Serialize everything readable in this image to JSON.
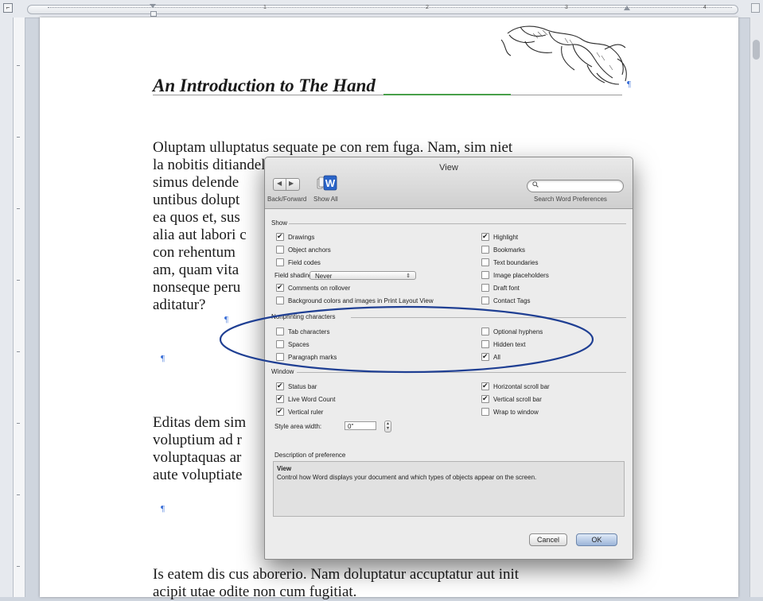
{
  "ruler": {
    "numbers": [
      "1",
      "2",
      "3",
      "4"
    ]
  },
  "document": {
    "title": "An Introduction to The Hand",
    "paragraph1": "Oluptam ulluptatus sequate pe con rem fuga. Nam, sim niet\nla nobitis ditiandel id ut a quae omnimolut et as ex et enis\nsimus delende\nuntibus dolupt\nea quos et, sus\nalia aut labori c\ncon rehentum\nam, quam vita\nnonseque peru\naditatur?",
    "paragraph2": "Editas dem sim\nvoluptium ad r\nvoluptaquas ar\naute voluptiate",
    "paragraph3": "Is eatem dis cus aborerio. Nam doluptatur accuptatur aut init\nacipit utae odite non cum fugitiat.",
    "pilcrow": "¶"
  },
  "dialog": {
    "title": "View",
    "back_forward_label": "Back/Forward",
    "show_all_label": "Show All",
    "search_caption": "Search Word Preferences",
    "search_placeholder": "",
    "groups": {
      "show": "Show",
      "nonprinting": "Nonprinting characters",
      "window": "Window",
      "description": "Description of preference"
    },
    "show_left": [
      {
        "label": "Drawings",
        "checked": true
      },
      {
        "label": "Object anchors",
        "checked": false
      },
      {
        "label": "Field codes",
        "checked": false
      }
    ],
    "field_shading_label": "Field shading:",
    "field_shading_value": "Never",
    "show_left2": [
      {
        "label": "Comments on rollover",
        "checked": true
      },
      {
        "label": "Background colors and images in Print Layout View",
        "checked": false
      }
    ],
    "show_right": [
      {
        "label": "Highlight",
        "checked": true
      },
      {
        "label": "Bookmarks",
        "checked": false
      },
      {
        "label": "Text boundaries",
        "checked": false
      },
      {
        "label": "Image placeholders",
        "checked": false
      },
      {
        "label": "Draft font",
        "checked": false
      },
      {
        "label": "Contact Tags",
        "checked": false
      }
    ],
    "nonprinting_left": [
      {
        "label": "Tab characters",
        "checked": false
      },
      {
        "label": "Spaces",
        "checked": false
      },
      {
        "label": "Paragraph marks",
        "checked": false
      }
    ],
    "nonprinting_right": [
      {
        "label": "Optional hyphens",
        "checked": false
      },
      {
        "label": "Hidden text",
        "checked": false
      },
      {
        "label": "All",
        "checked": true
      }
    ],
    "window_left": [
      {
        "label": "Status bar",
        "checked": true
      },
      {
        "label": "Live Word Count",
        "checked": true
      },
      {
        "label": "Vertical ruler",
        "checked": true
      }
    ],
    "window_right": [
      {
        "label": "Horizontal scroll bar",
        "checked": true
      },
      {
        "label": "Vertical scroll bar",
        "checked": true
      },
      {
        "label": "Wrap to window",
        "checked": false
      }
    ],
    "style_area_label": "Style area width:",
    "style_area_value": "0\"",
    "description_heading": "View",
    "description_text": "Control how Word displays your document and which types of objects appear on the screen.",
    "cancel_label": "Cancel",
    "ok_label": "OK"
  },
  "colors": {
    "pilcrow": "#3a6fd8",
    "annotation": "#1f3f93",
    "grammar_squiggle": "#48a04a"
  }
}
